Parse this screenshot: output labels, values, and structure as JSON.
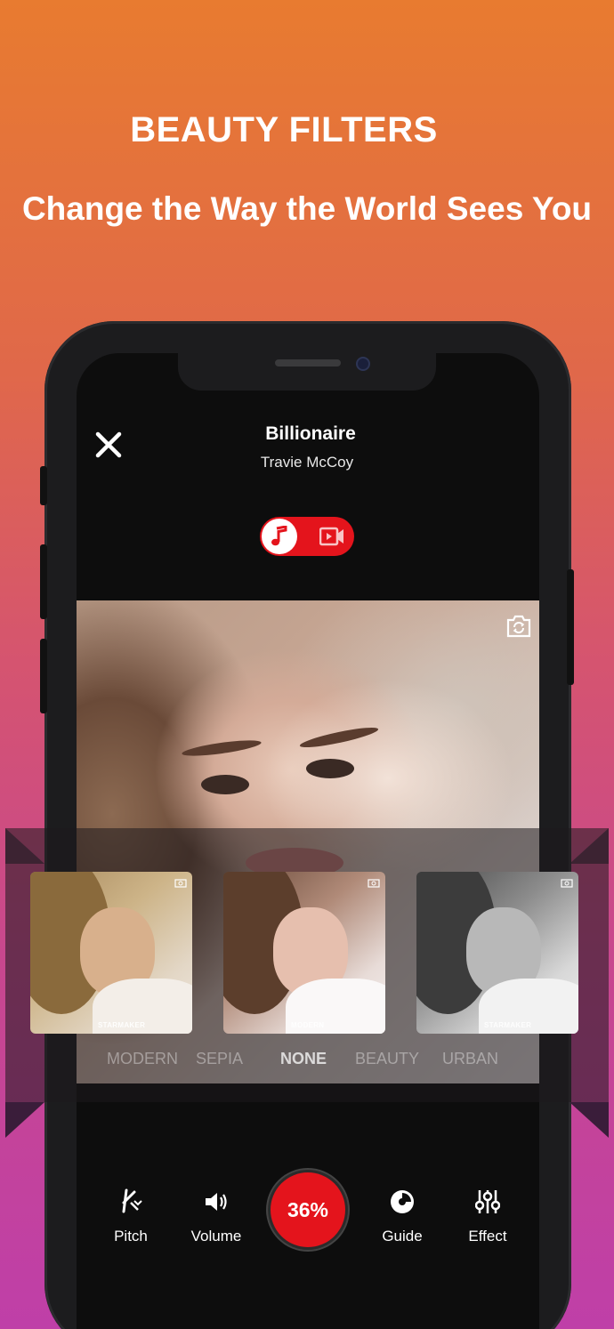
{
  "promo": {
    "headline": "BEAUTY FILTERS",
    "subheadline": "Change the Way the World Sees You"
  },
  "header": {
    "song_title": "Billionaire",
    "artist": "Travie McCoy"
  },
  "mode_toggle": {
    "selected": "audio",
    "options": [
      "audio",
      "video"
    ]
  },
  "filters": {
    "thumbnails": [
      {
        "name": "Starmaker",
        "watermark": "STARMAKER",
        "tone": "warm"
      },
      {
        "name": "Modern",
        "watermark": "MODERN",
        "tone": "natural"
      },
      {
        "name": "Starmaker",
        "watermark": "STARMAKER",
        "tone": "mono"
      }
    ],
    "labels": [
      "MODERN",
      "SEPIA",
      "NONE",
      "BEAUTY",
      "URBAN"
    ],
    "selected": "NONE"
  },
  "controls": {
    "pitch": "Pitch",
    "volume": "Volume",
    "record_progress": "36%",
    "guide": "Guide",
    "effect": "Effect"
  },
  "colors": {
    "accent": "#E4141C",
    "gradient_top": "#E87B30",
    "gradient_bottom": "#BF3FA8"
  }
}
